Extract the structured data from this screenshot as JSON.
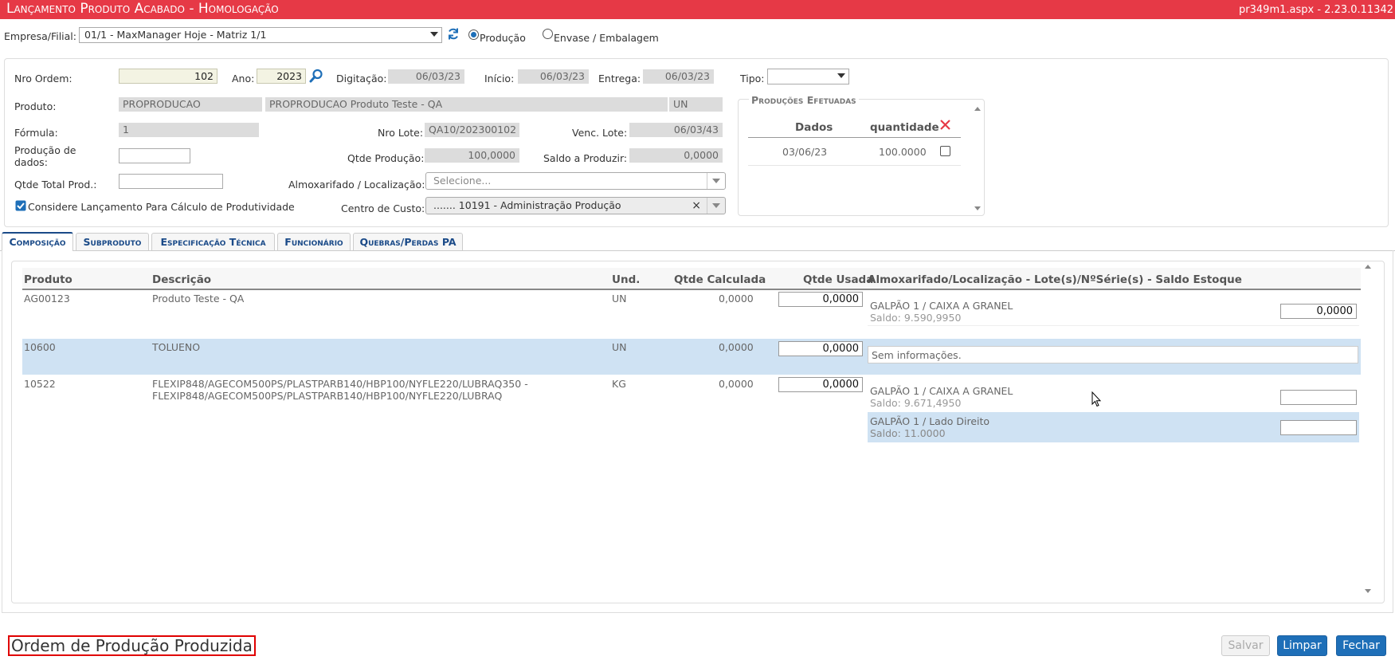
{
  "header": {
    "title": "Lançamento Produto Acabado  - Homologação",
    "version": "pr349m1.aspx - 2.23.0.11342"
  },
  "company": {
    "label": "Empresa/Filial:",
    "selected": "01/1 - MaxManager Hoje - Matriz 1/1",
    "radio_producao": "Produção",
    "radio_envase": "Envase / Embalagem"
  },
  "form": {
    "nro_ordem_label": "Nro Ordem:",
    "nro_ordem": "102",
    "ano_label": "Ano:",
    "ano": "2023",
    "digitacao_label": "Digitação:",
    "digitacao": "06/03/23",
    "inicio_label": "Início:",
    "inicio": "06/03/23",
    "entrega_label": "Entrega:",
    "entrega": "06/03/23",
    "tipo_label": "Tipo:",
    "produto_label": "Produto:",
    "produto_codigo": "PROPRODUCAO",
    "produto_descricao": "PROPRODUCAO Produto Teste - QA",
    "produto_unidade": "UN",
    "formula_label": "Fórmula:",
    "formula": "1",
    "nro_lote_label": "Nro Lote:",
    "nro_lote": "QA10/202300102",
    "venc_lote_label": "Venc. Lote:",
    "venc_lote": "06/03/43",
    "producao_dados_label": "Produção de dados:",
    "qtde_producao_label": "Qtde Produção:",
    "qtde_producao": "100,0000",
    "saldo_label": "Saldo a Produzir:",
    "saldo": "0,0000",
    "qtde_total_label": "Qtde Total Prod.:",
    "almox_label": "Almoxarifado / Localização:",
    "almox_placeholder": "Selecione...",
    "considere_label": "Considere Lançamento Para Cálculo de Produtividade",
    "centro_custo_label": "Centro de Custo:",
    "centro_custo": "....... 10191 - Administração Produção"
  },
  "producoes": {
    "title": "Produções Efetuadas",
    "col_dados": "Dados",
    "col_quantidade": "quantidade",
    "rows": [
      {
        "dados": "03/06/23",
        "quantidade": "100.0000"
      }
    ]
  },
  "tabs": [
    {
      "label": "Composição"
    },
    {
      "label": "Subproduto"
    },
    {
      "label": "Especificação Técnica"
    },
    {
      "label": "Funcionário"
    },
    {
      "label": "Quebras/Perdas PA"
    }
  ],
  "grid": {
    "headers": {
      "produto": "Produto",
      "descricao": "Descrição",
      "und": "Und.",
      "qtde_calculada": "Qtde Calculada",
      "qtde_usada": "Qtde Usada",
      "almox": "Almoxarifado/Localização - Lote(s)/NºSérie(s) - Saldo Estoque"
    },
    "rows": [
      {
        "produto": "AG00123",
        "descricao1": "Produto Teste - QA",
        "descricao2": "",
        "und": "UN",
        "qtde_calculada": "0,0000",
        "qtde_usada": "0,0000",
        "loc1_name": "GALPÃO 1 / CAIXA A GRANEL",
        "loc1_saldo": "Saldo: 9.590,9950",
        "loc1_value": "0,0000"
      },
      {
        "produto": "10600",
        "descricao1": "TOLUENO",
        "und": "UN",
        "qtde_calculada": "0,0000",
        "qtde_usada": "0,0000",
        "info": "Sem informações."
      },
      {
        "produto": "10522",
        "descricao1": "FLEXIP848/AGECOM500PS/PLASTPARB140/HBP100/NYFLE220/LUBRAQ350 -",
        "descricao2": "FLEXIP848/AGECOM500PS/PLASTPARB140/HBP100/NYFLE220/LUBRAQ",
        "und": "KG",
        "qtde_calculada": "0,0000",
        "qtde_usada": "0,0000",
        "loc1_name": "GALPÃO 1 / CAIXA A GRANEL",
        "loc1_saldo": "Saldo: 9.671,4950",
        "loc2_name": "GALPÃO 1 / Lado Direito",
        "loc2_saldo": "Saldo: 11.0000"
      }
    ]
  },
  "footer": {
    "status": "Ordem de Produção Produzida",
    "salvar": "Salvar",
    "limpar": "Limpar",
    "fechar": "Fechar"
  },
  "colors": {
    "titlebar": "#e63946",
    "accent_blue": "#1e6fb8",
    "row_highlight": "#cfe2f3"
  }
}
